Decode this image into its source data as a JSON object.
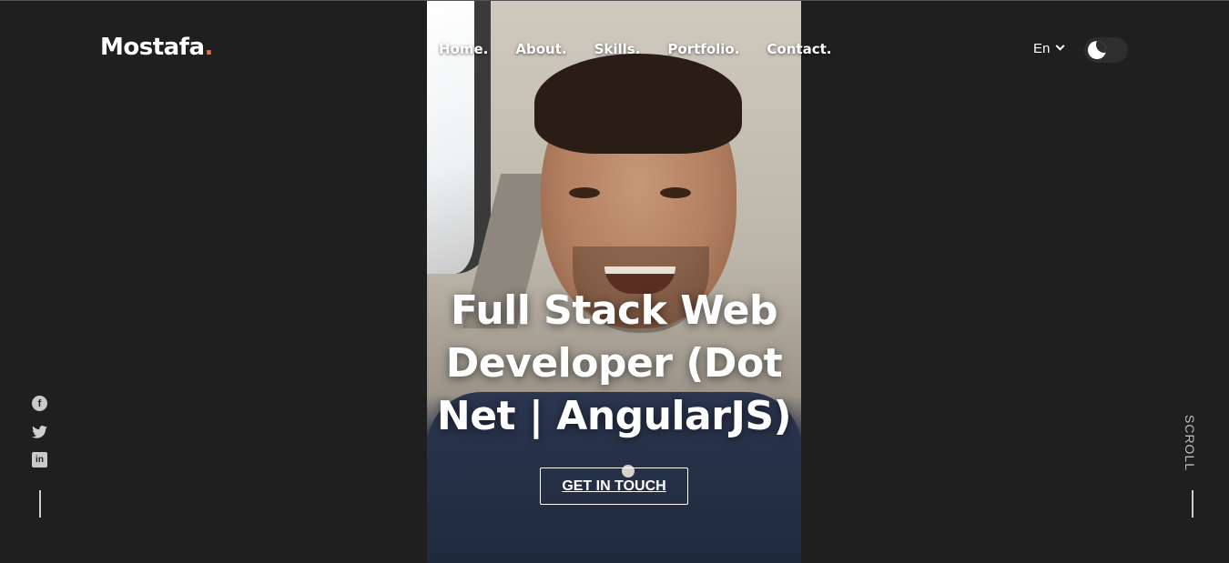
{
  "header": {
    "logo_text": "Mostafa",
    "logo_dot": ".",
    "logo_accent_color": "#f26b3a",
    "nav": [
      {
        "label": "Home."
      },
      {
        "label": "About."
      },
      {
        "label": "Skills."
      },
      {
        "label": "Portfolio."
      },
      {
        "label": "Contact."
      }
    ],
    "language": "En",
    "theme_toggle_icon": "moon-icon"
  },
  "hero": {
    "title": "Full Stack Web Developer (Dot Net | AngularJS)",
    "cta_label": "GET IN TOUCH",
    "photo_icon": "profile-photo"
  },
  "social": [
    {
      "icon": "facebook-icon",
      "glyph": "f"
    },
    {
      "icon": "twitter-icon",
      "glyph": "🐦"
    },
    {
      "icon": "linkedin-icon",
      "glyph": "in"
    }
  ],
  "scroll_label": "SCROLL",
  "colors": {
    "background": "#1f1f1f",
    "text": "#ffffff"
  }
}
